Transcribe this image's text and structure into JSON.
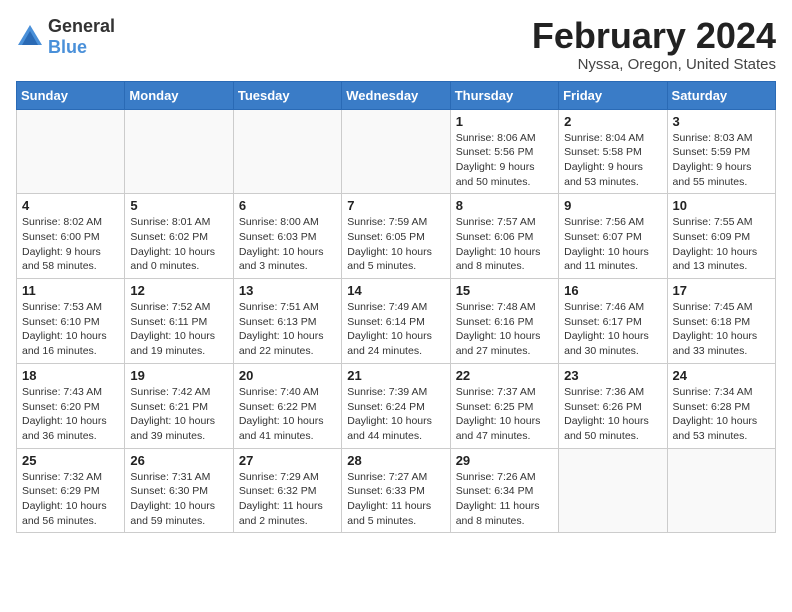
{
  "logo": {
    "general": "General",
    "blue": "Blue"
  },
  "title": "February 2024",
  "location": "Nyssa, Oregon, United States",
  "days_of_week": [
    "Sunday",
    "Monday",
    "Tuesday",
    "Wednesday",
    "Thursday",
    "Friday",
    "Saturday"
  ],
  "weeks": [
    [
      {
        "day": "",
        "info": ""
      },
      {
        "day": "",
        "info": ""
      },
      {
        "day": "",
        "info": ""
      },
      {
        "day": "",
        "info": ""
      },
      {
        "day": "1",
        "info": "Sunrise: 8:06 AM\nSunset: 5:56 PM\nDaylight: 9 hours and 50 minutes."
      },
      {
        "day": "2",
        "info": "Sunrise: 8:04 AM\nSunset: 5:58 PM\nDaylight: 9 hours and 53 minutes."
      },
      {
        "day": "3",
        "info": "Sunrise: 8:03 AM\nSunset: 5:59 PM\nDaylight: 9 hours and 55 minutes."
      }
    ],
    [
      {
        "day": "4",
        "info": "Sunrise: 8:02 AM\nSunset: 6:00 PM\nDaylight: 9 hours and 58 minutes."
      },
      {
        "day": "5",
        "info": "Sunrise: 8:01 AM\nSunset: 6:02 PM\nDaylight: 10 hours and 0 minutes."
      },
      {
        "day": "6",
        "info": "Sunrise: 8:00 AM\nSunset: 6:03 PM\nDaylight: 10 hours and 3 minutes."
      },
      {
        "day": "7",
        "info": "Sunrise: 7:59 AM\nSunset: 6:05 PM\nDaylight: 10 hours and 5 minutes."
      },
      {
        "day": "8",
        "info": "Sunrise: 7:57 AM\nSunset: 6:06 PM\nDaylight: 10 hours and 8 minutes."
      },
      {
        "day": "9",
        "info": "Sunrise: 7:56 AM\nSunset: 6:07 PM\nDaylight: 10 hours and 11 minutes."
      },
      {
        "day": "10",
        "info": "Sunrise: 7:55 AM\nSunset: 6:09 PM\nDaylight: 10 hours and 13 minutes."
      }
    ],
    [
      {
        "day": "11",
        "info": "Sunrise: 7:53 AM\nSunset: 6:10 PM\nDaylight: 10 hours and 16 minutes."
      },
      {
        "day": "12",
        "info": "Sunrise: 7:52 AM\nSunset: 6:11 PM\nDaylight: 10 hours and 19 minutes."
      },
      {
        "day": "13",
        "info": "Sunrise: 7:51 AM\nSunset: 6:13 PM\nDaylight: 10 hours and 22 minutes."
      },
      {
        "day": "14",
        "info": "Sunrise: 7:49 AM\nSunset: 6:14 PM\nDaylight: 10 hours and 24 minutes."
      },
      {
        "day": "15",
        "info": "Sunrise: 7:48 AM\nSunset: 6:16 PM\nDaylight: 10 hours and 27 minutes."
      },
      {
        "day": "16",
        "info": "Sunrise: 7:46 AM\nSunset: 6:17 PM\nDaylight: 10 hours and 30 minutes."
      },
      {
        "day": "17",
        "info": "Sunrise: 7:45 AM\nSunset: 6:18 PM\nDaylight: 10 hours and 33 minutes."
      }
    ],
    [
      {
        "day": "18",
        "info": "Sunrise: 7:43 AM\nSunset: 6:20 PM\nDaylight: 10 hours and 36 minutes."
      },
      {
        "day": "19",
        "info": "Sunrise: 7:42 AM\nSunset: 6:21 PM\nDaylight: 10 hours and 39 minutes."
      },
      {
        "day": "20",
        "info": "Sunrise: 7:40 AM\nSunset: 6:22 PM\nDaylight: 10 hours and 41 minutes."
      },
      {
        "day": "21",
        "info": "Sunrise: 7:39 AM\nSunset: 6:24 PM\nDaylight: 10 hours and 44 minutes."
      },
      {
        "day": "22",
        "info": "Sunrise: 7:37 AM\nSunset: 6:25 PM\nDaylight: 10 hours and 47 minutes."
      },
      {
        "day": "23",
        "info": "Sunrise: 7:36 AM\nSunset: 6:26 PM\nDaylight: 10 hours and 50 minutes."
      },
      {
        "day": "24",
        "info": "Sunrise: 7:34 AM\nSunset: 6:28 PM\nDaylight: 10 hours and 53 minutes."
      }
    ],
    [
      {
        "day": "25",
        "info": "Sunrise: 7:32 AM\nSunset: 6:29 PM\nDaylight: 10 hours and 56 minutes."
      },
      {
        "day": "26",
        "info": "Sunrise: 7:31 AM\nSunset: 6:30 PM\nDaylight: 10 hours and 59 minutes."
      },
      {
        "day": "27",
        "info": "Sunrise: 7:29 AM\nSunset: 6:32 PM\nDaylight: 11 hours and 2 minutes."
      },
      {
        "day": "28",
        "info": "Sunrise: 7:27 AM\nSunset: 6:33 PM\nDaylight: 11 hours and 5 minutes."
      },
      {
        "day": "29",
        "info": "Sunrise: 7:26 AM\nSunset: 6:34 PM\nDaylight: 11 hours and 8 minutes."
      },
      {
        "day": "",
        "info": ""
      },
      {
        "day": "",
        "info": ""
      }
    ]
  ]
}
